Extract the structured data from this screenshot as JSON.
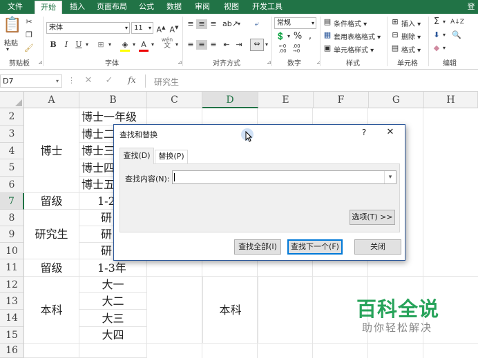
{
  "tabs": [
    {
      "label": "文件",
      "active": false
    },
    {
      "label": "开始",
      "active": true
    },
    {
      "label": "插入",
      "active": false
    },
    {
      "label": "页面布局",
      "active": false
    },
    {
      "label": "公式",
      "active": false
    },
    {
      "label": "数据",
      "active": false
    },
    {
      "label": "审阅",
      "active": false
    },
    {
      "label": "视图",
      "active": false
    },
    {
      "label": "开发工具",
      "active": false
    },
    {
      "label": "登",
      "active": false
    }
  ],
  "ribbon": {
    "clipboard": {
      "paste_label": "粘贴",
      "group_label": "剪贴板"
    },
    "font": {
      "font_name": "宋体",
      "font_size": "11",
      "group_label": "字体",
      "wen_label": "wén"
    },
    "alignment": {
      "group_label": "对齐方式"
    },
    "number": {
      "format": "常规",
      "group_label": "数字"
    },
    "styles": {
      "conditional": "条件格式",
      "table_format": "套用表格格式",
      "cell_styles": "单元格样式",
      "group_label": "样式"
    },
    "cells": {
      "insert": "插入",
      "delete": "删除",
      "format": "格式",
      "group_label": "单元格"
    },
    "editing": {
      "group_label": "编辑"
    }
  },
  "formula_bar": {
    "name_box": "D7",
    "fx": "fx",
    "content": "研究生"
  },
  "columns": [
    "A",
    "B",
    "C",
    "D",
    "E",
    "F",
    "G",
    "H"
  ],
  "selected_column": "D",
  "rows": [
    "2",
    "3",
    "4",
    "5",
    "6",
    "7",
    "8",
    "9",
    "10",
    "11",
    "12",
    "13",
    "14",
    "15",
    "16"
  ],
  "selected_row": "7",
  "cells": {
    "A_bo": "博士",
    "A_7": "留级",
    "A_yjs": "研究生",
    "A_11": "留级",
    "A_bk": "本科",
    "B_2": "博士一年级",
    "B_3": "博士二",
    "B_4": "博士三",
    "B_5": "博士四",
    "B_6": "博士五",
    "B_7": "1-2",
    "B_8": "研",
    "B_9": "研",
    "B_10": "研",
    "B_11": "1-3年",
    "B_12": "大一",
    "B_13": "大二",
    "B_14": "大三",
    "B_15": "大四",
    "D_bk": "本科"
  },
  "dialog": {
    "title": "查找和替换",
    "help": "?",
    "close": "✕",
    "tab_find": "查找(D)",
    "tab_replace": "替换(P)",
    "find_label": "查找内容(N):",
    "find_value": "",
    "options_button": "选项(T) >>",
    "find_all_button": "查找全部(I)",
    "find_next_button": "查找下一个(F)",
    "close_button": "关闭"
  },
  "watermark": {
    "title": "百科全说",
    "subtitle": "助你轻松解决"
  }
}
